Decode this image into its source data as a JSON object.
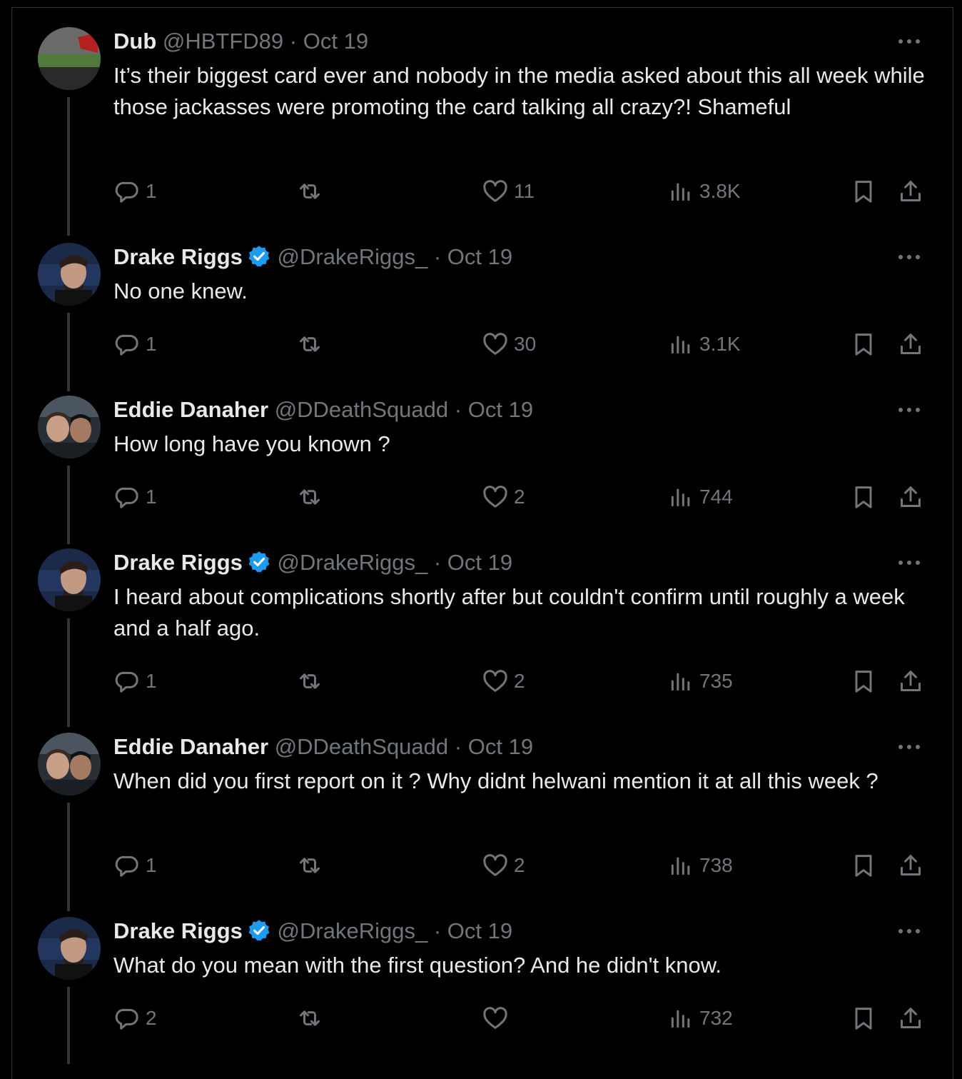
{
  "tweets": [
    {
      "name": "Dub",
      "verified": false,
      "handle": "@HBTFD89",
      "sep": "·",
      "date": "Oct 19",
      "text": "It’s their biggest card ever and nobody in the media asked about this all week while those jackasses were promoting the card talking all crazy?! Shameful",
      "replies": "1",
      "retweets": "",
      "likes": "11",
      "views": "3.8K"
    },
    {
      "name": "Drake Riggs",
      "verified": true,
      "handle": "@DrakeRiggs_",
      "sep": "·",
      "date": "Oct 19",
      "text": "No one knew.",
      "replies": "1",
      "retweets": "",
      "likes": "30",
      "views": "3.1K"
    },
    {
      "name": "Eddie Danaher",
      "verified": false,
      "handle": "@DDeathSquadd",
      "sep": "·",
      "date": "Oct 19",
      "text": "How long have you known ?",
      "replies": "1",
      "retweets": "",
      "likes": "2",
      "views": "744"
    },
    {
      "name": "Drake Riggs",
      "verified": true,
      "handle": "@DrakeRiggs_",
      "sep": "·",
      "date": "Oct 19",
      "text": "I heard about complications shortly after but couldn't confirm until roughly a week and a half ago.",
      "replies": "1",
      "retweets": "",
      "likes": "2",
      "views": "735"
    },
    {
      "name": "Eddie Danaher",
      "verified": false,
      "handle": "@DDeathSquadd",
      "sep": "·",
      "date": "Oct 19",
      "text": "When did you first report on it ? Why didnt helwani mention it at all this week ?",
      "replies": "1",
      "retweets": "",
      "likes": "2",
      "views": "738"
    },
    {
      "name": "Drake Riggs",
      "verified": true,
      "handle": "@DrakeRiggs_",
      "sep": "·",
      "date": "Oct 19",
      "text": "What do you mean with the first question? And he didn't know.",
      "replies": "2",
      "retweets": "",
      "likes": "",
      "views": "732"
    }
  ],
  "icons": {
    "reply": "reply-icon",
    "retweet": "retweet-icon",
    "like": "heart-icon",
    "views": "views-icon",
    "bookmark": "bookmark-icon",
    "share": "share-icon",
    "more": "more-icon",
    "verified": "verified-badge-icon"
  },
  "colors": {
    "background": "#000000",
    "text": "#e7e9ea",
    "muted": "#71767b",
    "verified": "#1d9bf0",
    "divider": "#2f3336"
  }
}
